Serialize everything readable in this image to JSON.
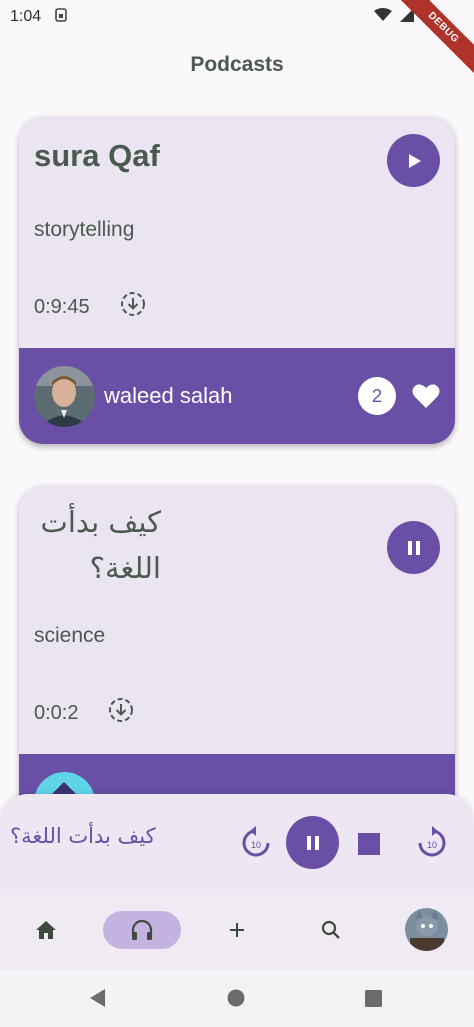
{
  "status_bar": {
    "time": "1:04",
    "sim_icon": "sim-card-icon",
    "debug_label": "DEBUG"
  },
  "app_bar": {
    "title": "Podcasts"
  },
  "podcasts": [
    {
      "title": "sura Qaf",
      "category": "storytelling",
      "duration": "0:9:45",
      "author": "waleed salah",
      "likes": "2",
      "playing": false
    },
    {
      "title": "كيف بدأت اللغة؟",
      "category": "science",
      "duration": "0:0:2",
      "author": "",
      "likes": "",
      "playing": true
    }
  ],
  "mini_player": {
    "title": "كيف بدأت اللغة؟",
    "rewind_seconds": "10",
    "forward_seconds": "10"
  },
  "bottom_nav": {
    "items": [
      "home-icon",
      "headphones-icon",
      "add-icon",
      "search-icon",
      "profile-avatar"
    ],
    "selected": "headphones-icon"
  },
  "colors": {
    "primary": "#6a4fa6",
    "card": "#ebe5f1",
    "text": "#4b5a4f",
    "nav_pill": "#c4b3e0"
  }
}
